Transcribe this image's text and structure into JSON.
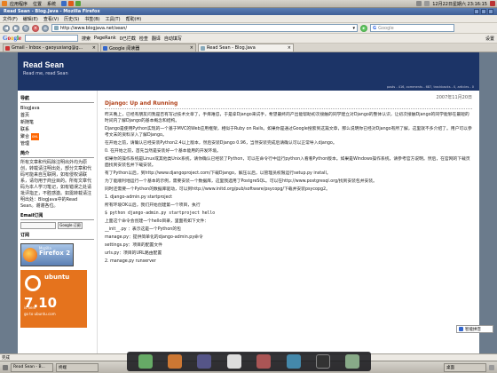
{
  "desktop": {
    "menus": [
      "应用程序",
      "位置",
      "系统"
    ],
    "clock": "12月22日星期六 23:16:15",
    "colors": {
      "accent": "#3e5f97",
      "header": "#1c3467",
      "link": "#2855b2",
      "title": "#b04018"
    }
  },
  "window": {
    "title": "Read Sean - Blog.Java - Mozilla Firefox"
  },
  "menu": [
    "文件(F)",
    "编辑(E)",
    "查看(V)",
    "历史(S)",
    "书签(B)",
    "工具(T)",
    "帮助(H)"
  ],
  "nav": {
    "url": "http://www.blogjava.net/sean/",
    "search_placeholder": "Google"
  },
  "gtoolbar": {
    "logo": "Google",
    "items": [
      "搜索",
      "PageRank",
      "0已拦截",
      "检查",
      "翻译",
      "自动填写",
      "设置"
    ]
  },
  "tabs": [
    {
      "label": "Gmail - Inbox - gaoyuxiang@g..."
    },
    {
      "label": "Google 阅读器"
    },
    {
      "label": "Read Sean - Blog.Java"
    }
  ],
  "blog": {
    "title": "Read Sean",
    "tagline": "Read me, read Sean",
    "stats": "posts - 416, comments - 687, trackbacks - 0, articles - 0"
  },
  "sidebar": {
    "nav_title": "导航",
    "nav_items": [
      "BlogJava",
      "首页",
      "新随笔",
      "联系",
      "聚合",
      "管理"
    ],
    "about_title": "简介",
    "about": "所有文章和代码除注明出外均为原创，转载请注明出处，部分文章和代码可能来自互联网，如有侵权请联系，请勿用于商业目的。所有文章代码为本人学习笔记，如有错误之处请批评指正，不胜感激。如需转载请注明出处：BlogJava中的Read Sean。谢谢各位。",
    "subscribe_title": "Email订阅",
    "gbutton": "Google 订阅",
    "feed_title": "订阅",
    "firefox": {
      "small": "Mozilla",
      "big": "Firefox 2"
    },
    "ubuntu": {
      "name": "ubuntu",
      "version": "7.10",
      "tag": "is here",
      "link": "go to ubuntu.com"
    }
  },
  "post": {
    "date": "2007年11月20日",
    "title": "Django: Up and Running",
    "paras": [
      "昨天晚上，已经有朋友问我是否有写过技术文章了，手痒难忍，于是拿Django来试手，希望最终的产出能帮助初次接触的同学建立对Django的整体认识，让初次接触Django的同学能够在最短的时间内了解Django的基本概念和结构。",
      "Django是使用Python实现的一个基于MVC的Web应用框架，相似于Ruby on Rails。如果你是通过Google搜索到这篇文章，那么说明你已经对Django有所了解，这里就不多介绍了。用户可以参考文末的资料深入了解Django。",
      "在开始之前，请确认已经安装Python2.4以上版本，然后安装Django 0.96，当然安装完成后请确认可以正常导入django。",
      "0. 在开始之前，首先当然是安装好一个基本能用的开发环境。",
      "如果你的操作系统是Linux或其他类Unix系统，请你确认已经装了Python，可以在命令行中运行python入看看Python版本。如果是Windows操作系统，请参考官方说明。然后，在官网的下载页面找到安装包并下载安装。",
      "有了Python以后，到http://www.djangoproject.com/下载Django，解压以后，以管理员权限运行setup.py install。",
      "为了能顺利地运行一个基本的示例，需要安装一个数据库，这里我选用了PostgreSQL。可以在http://www.postgresql.org/找到安装包并安装。",
      "同时还需要一个Python的数据库驱动，可以到http://www.initd.org/pub/software/psycopg/下载并安装psycopg2。",
      "1. django-admin.py startproject",
      "所有环境OK以后，我们开始创建第一个项目，执行",
      "$ python django-admin.py startproject hello",
      "上面这个命令会创建一个hello目录，里面有如下文件：",
      "__init__.py ：表示这是一个Python的包",
      "manage.py：提供简单化的django-admin.py命令",
      "settings.py：项目的配置文件",
      "urls.py：项目的URL路由配置",
      "2. manage.py runserver"
    ]
  },
  "status": {
    "text": "完成",
    "url": "http://www.blogjava.net/sean/"
  },
  "taskbar": {
    "tasks": [
      "Read Sean - B...",
      "终端",
      "桌面"
    ]
  },
  "ime": {
    "label": "智能拼音"
  }
}
